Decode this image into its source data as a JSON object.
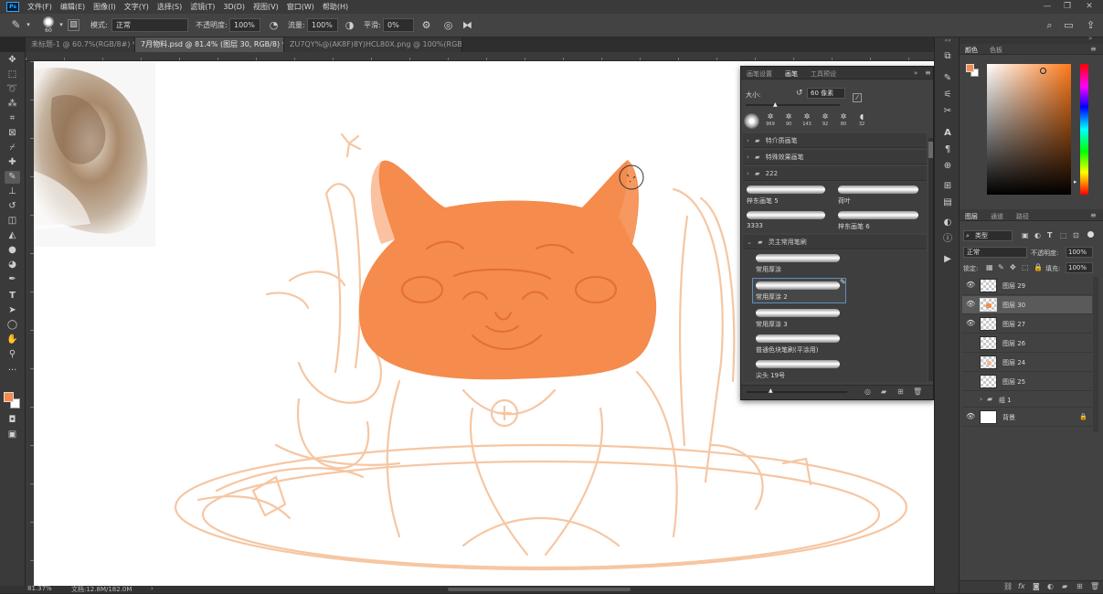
{
  "app": {
    "logo": "Ps"
  },
  "menu": [
    "文件(F)",
    "编辑(E)",
    "图像(I)",
    "文字(Y)",
    "选择(S)",
    "滤镜(T)",
    "3D(D)",
    "视图(V)",
    "窗口(W)",
    "帮助(H)"
  ],
  "window_controls": [
    "—",
    "❐",
    "✕"
  ],
  "options": {
    "brush_size": "60",
    "mode_label": "模式:",
    "mode_value": "正常",
    "opacity_label": "不透明度:",
    "opacity_value": "100%",
    "flow_label": "流量:",
    "flow_value": "100%",
    "smooth_label": "平滑:",
    "smooth_value": "0%"
  },
  "tabs": [
    {
      "label": "未标题-1 @ 60.7%(RGB/8#) *",
      "close": "×"
    },
    {
      "label": "7月物料.psd @ 81.4% (图层 30, RGB/8) *",
      "close": "×"
    },
    {
      "label": "ZU7QY%@(AK8F)8Y)HCL80X.png @ 100%(RGB/8)",
      "close": "×"
    }
  ],
  "tools": [
    "move-icon",
    "marquee-icon",
    "lasso-icon",
    "magic-wand-icon",
    "crop-icon",
    "frame-icon",
    "eyedropper-icon",
    "healing-icon",
    "brush-icon",
    "stamp-icon",
    "history-brush-icon",
    "eraser-icon",
    "bucket-icon",
    "blur-icon",
    "dodge-icon",
    "pen-icon",
    "text-icon",
    "path-select-icon",
    "ellipse-icon",
    "hand-icon",
    "zoom-icon",
    "more-icon"
  ],
  "colors": {
    "foreground": "#f58b4c",
    "background": "#ffffff",
    "paint": "#f58b4c",
    "sketch": "#f7c9a6",
    "accent": "#31a8ff"
  },
  "status": {
    "zoom": "81.37%",
    "doc": "文档:12.8M/182.0M"
  },
  "brush_panel": {
    "tabs": [
      "画笔设置",
      "画笔",
      "工具预设"
    ],
    "size_label": "大小:",
    "size_value": "60 像素",
    "presets": [
      "969",
      "90",
      "143",
      "92",
      "80",
      "32"
    ],
    "folders": [
      {
        "name": "特介质画笔"
      },
      {
        "name": "特殊效果画笔"
      },
      {
        "name": "222"
      }
    ],
    "grid_brushes": [
      "梓东画笔 5",
      "荷叶",
      "3333",
      "梓东画笔 6"
    ],
    "open_folder": "灵主常用笔刷",
    "brushes": [
      "常用厚涂",
      "常用厚涂 2",
      "常用厚涂 3",
      "普通色块笔刷(平涂用)",
      "尖头 19号"
    ]
  },
  "color_panel": {
    "tabs": [
      "颜色",
      "色板"
    ]
  },
  "layers_panel": {
    "tabs": [
      "图层",
      "通道",
      "路径"
    ],
    "filter": "类型",
    "blend_mode": "正常",
    "opacity_label": "不透明度:",
    "opacity_value": "100%",
    "lock_label": "锁定:",
    "fill_label": "填充:",
    "fill_value": "100%",
    "layers": [
      {
        "name": "图层 29",
        "visible": true,
        "selected": false
      },
      {
        "name": "图层 30",
        "visible": true,
        "selected": true
      },
      {
        "name": "图层 27",
        "visible": true,
        "selected": false
      },
      {
        "name": "图层 26",
        "visible": false,
        "selected": false
      },
      {
        "name": "图层 24",
        "visible": false,
        "selected": false
      },
      {
        "name": "图层 25",
        "visible": false,
        "selected": false
      },
      {
        "name": "组 1",
        "visible": false,
        "selected": false
      },
      {
        "name": "背景",
        "visible": true,
        "selected": false
      }
    ]
  }
}
